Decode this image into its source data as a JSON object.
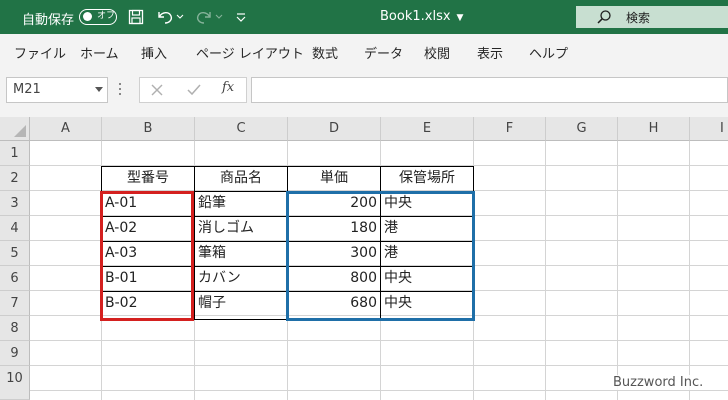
{
  "titlebar": {
    "autosave_label": "自動保存",
    "autosave_state": "オフ",
    "file_title": "Book1.xlsx",
    "search_placeholder": "検索",
    "bg_color": "#217346"
  },
  "ribbon": {
    "tabs": [
      "ファイル",
      "ホーム",
      "挿入",
      "ページ レイアウト",
      "数式",
      "データ",
      "校閲",
      "表示",
      "ヘルプ"
    ]
  },
  "formula_bar": {
    "name_box": "M21",
    "fx_label": "fx",
    "formula": ""
  },
  "sheet": {
    "columns": [
      "A",
      "B",
      "C",
      "D",
      "E",
      "F",
      "G",
      "H",
      "I"
    ],
    "rows": [
      "1",
      "2",
      "3",
      "4",
      "5",
      "6",
      "7",
      "8",
      "9",
      "10"
    ],
    "headers": [
      "型番号",
      "商品名",
      "単価",
      "保管場所"
    ],
    "data": [
      [
        "A-01",
        "鉛筆",
        "200",
        "中央"
      ],
      [
        "A-02",
        "消しゴム",
        "180",
        "港"
      ],
      [
        "A-03",
        "筆箱",
        "300",
        "港"
      ],
      [
        "B-01",
        "カバン",
        "800",
        "中央"
      ],
      [
        "B-02",
        "帽子",
        "680",
        "中央"
      ]
    ],
    "highlight_colors": {
      "key_column": "#d4201f",
      "value_columns": "#1f6fa8"
    }
  },
  "watermark": "Buzzword Inc."
}
